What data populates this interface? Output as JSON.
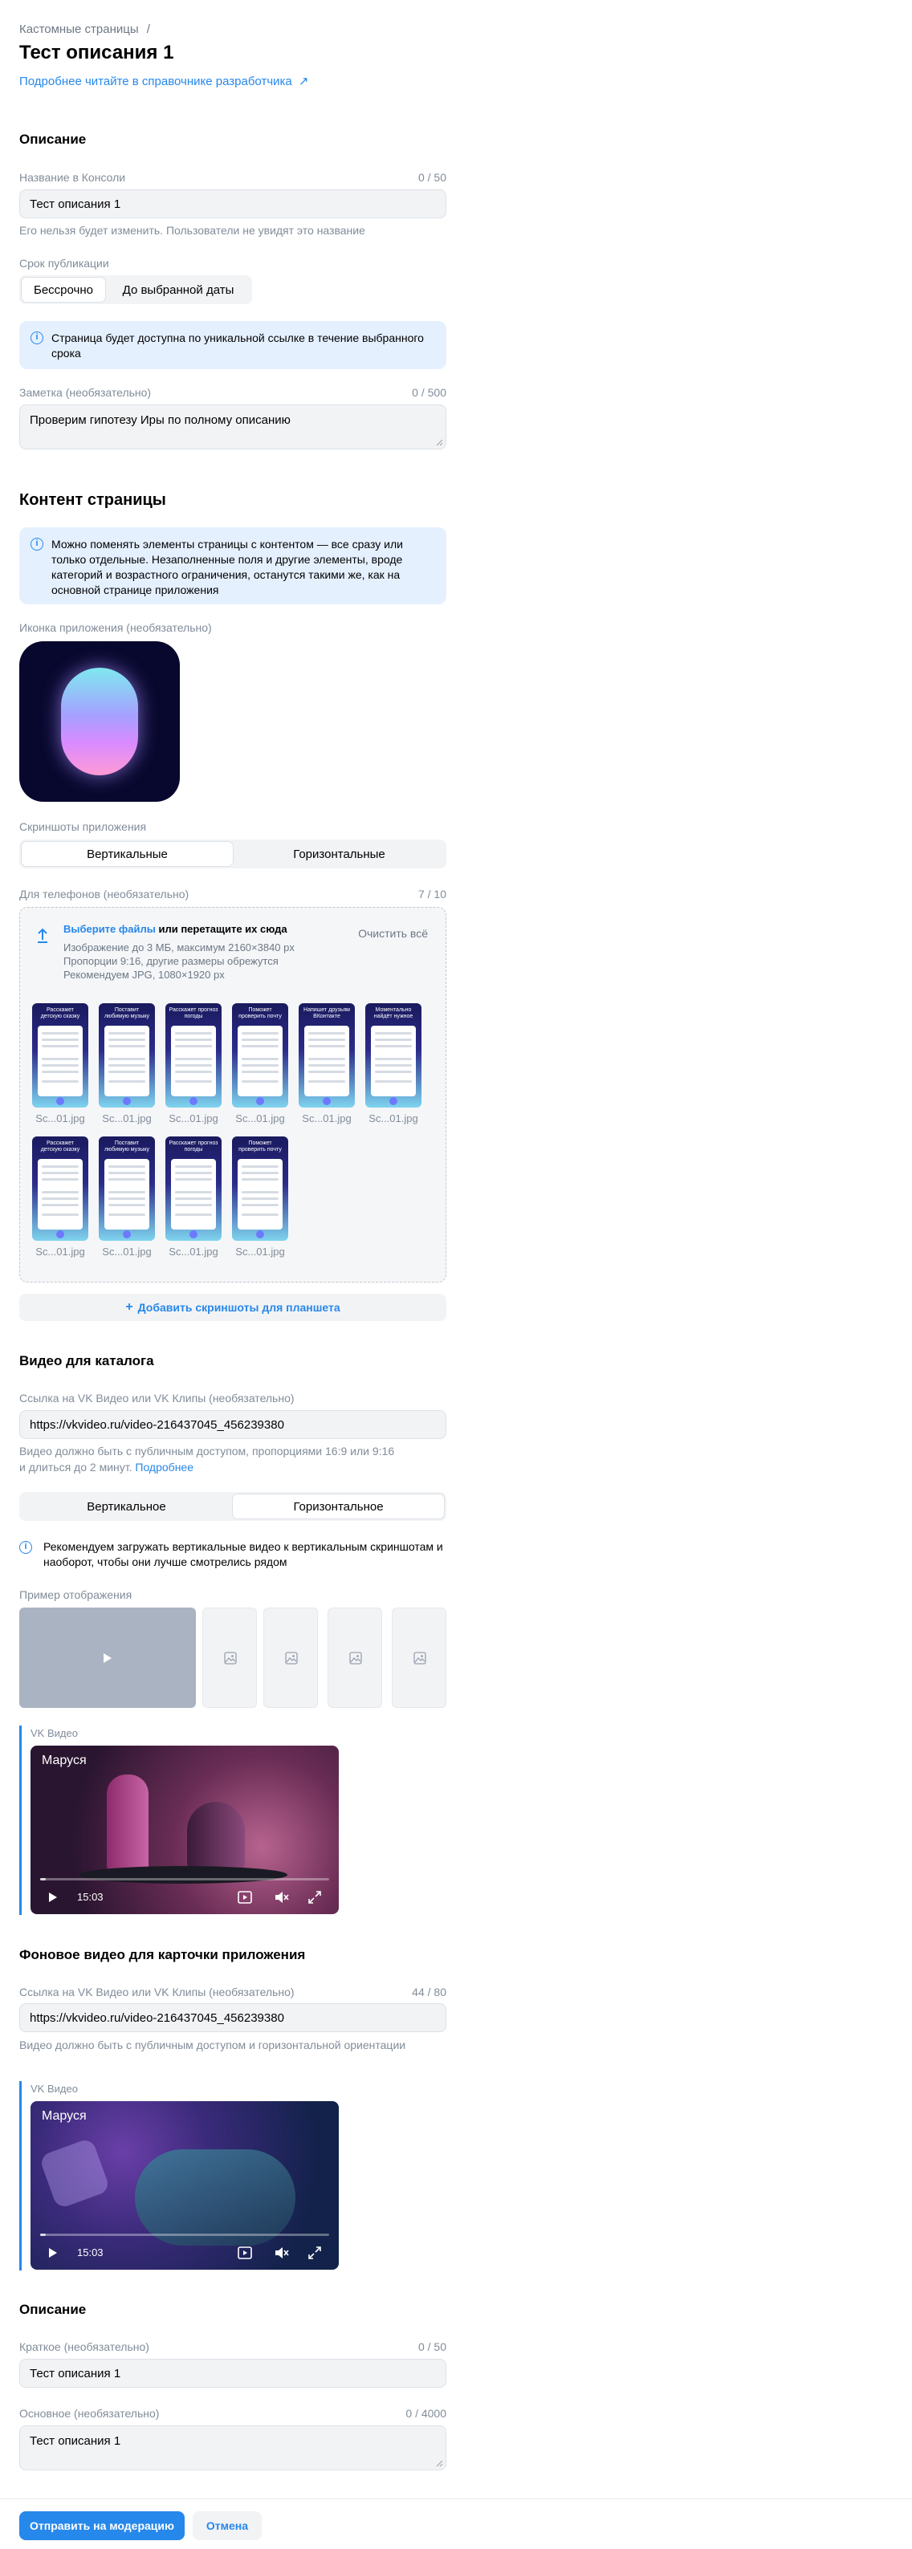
{
  "header": {
    "breadcrumb": "Кастомные страницы",
    "breadcrumb_sep": "/",
    "title": "Тест описания 1",
    "dev_link": "Подробнее читайте в справочнике разработчика"
  },
  "description_section": {
    "heading": "Описание",
    "console_name": {
      "label": "Название в Консоли",
      "counter": "0 / 50",
      "value": "Тест описания 1",
      "hint": "Его нельзя будет изменить. Пользователи не увидят это название"
    },
    "publication": {
      "label": "Срок публикации",
      "options": [
        "Бессрочно",
        "До выбранной даты"
      ],
      "selected": "Бессрочно"
    },
    "info": "Страница будет доступна по уникальной ссылке в течение выбранного срока",
    "note": {
      "label": "Заметка (необязательно)",
      "counter": "0 / 500",
      "value": "Проверим гипотезу Иры по полному описанию"
    }
  },
  "content_section": {
    "heading": "Контент страницы",
    "info": "Можно поменять элементы страницы с контентом — все сразу или только отдельные. Незаполненные поля и другие элементы, вроде категорий и возрастного ограничения, останутся такими же, как на основной странице приложения",
    "icon_label": "Иконка приложения (необязательно)",
    "screenshots_label": "Скриншоты приложения",
    "orientation_tabs": [
      "Вертикальные",
      "Горизонтальные"
    ],
    "orientation_selected": "Вертикальные",
    "phones": {
      "label": "Для телефонов (необязательно)",
      "counter": "7 / 10",
      "upload_link": "Выберите файлы",
      "upload_text": " или перетащите их сюда",
      "req1": "Изображение до 3 МБ, максимум 2160×3840 px",
      "req2": "Пропорции 9:16, другие размеры обрежутся",
      "req3": "Рекомендуем JPG, 1080×1920 px",
      "clear_all": "Очистить всё",
      "files": [
        {
          "name": "Sc...01.jpg",
          "caption": "Расскажет детскую сказку"
        },
        {
          "name": "Sc...01.jpg",
          "caption": "Поставит любимую музыку"
        },
        {
          "name": "Sc...01.jpg",
          "caption": "Расскажет прогноз погоды"
        },
        {
          "name": "Sc...01.jpg",
          "caption": "Поможет проверить почту"
        },
        {
          "name": "Sc...01.jpg",
          "caption": "Напишет друзьям ВКонтакте"
        },
        {
          "name": "Sc...01.jpg",
          "caption": "Моментально найдёт нужное"
        },
        {
          "name": "Sc...01.jpg",
          "caption": "Расскажет детскую сказку"
        },
        {
          "name": "Sc...01.jpg",
          "caption": "Поставит любимую музыку"
        },
        {
          "name": "Sc...01.jpg",
          "caption": "Расскажет прогноз погоды"
        },
        {
          "name": "Sc...01.jpg",
          "caption": "Поможет проверить почту"
        }
      ]
    },
    "add_tablet": "Добавить скриншоты для планшета"
  },
  "catalog_video": {
    "heading": "Видео для каталога",
    "label": "Ссылка на VK Видео или VK Клипы (необязательно)",
    "value": "https://vkvideo.ru/video-216437045_456239380",
    "hint1": "Видео должно быть с публичным доступом, пропорциями 16:9 или 9:16",
    "hint2": "и длиться до 2 минут.",
    "hint_link": "Подробнее",
    "orientation_tabs": [
      "Вертикальное",
      "Горизонтальное"
    ],
    "orientation_selected": "Горизонтальное",
    "info": "Рекомендуем загружать вертикальные видео к вертикальным скриншотам и наоборот, чтобы они лучше смотрелись рядом",
    "preview_label": "Пример отображения",
    "player": {
      "source": "VK Видео",
      "title": "Маруся",
      "time": "15:03",
      "progress": 0.02
    }
  },
  "background_video": {
    "heading": "Фоновое видео для карточки приложения",
    "label": "Ссылка на VK Видео или VK Клипы (необязательно)",
    "counter": "44 / 80",
    "value": "https://vkvideo.ru/video-216437045_456239380",
    "hint": "Видео должно быть с публичным доступом и горизонтальной ориентации",
    "player": {
      "source": "VK Видео",
      "title": "Маруся",
      "time": "15:03",
      "progress": 0.02
    }
  },
  "bottom_description": {
    "heading": "Описание",
    "short": {
      "label": "Краткое (необязательно)",
      "counter": "0 / 50",
      "value": "Тест описания 1"
    },
    "full": {
      "label": "Основное (необязательно)",
      "counter": "0 / 4000",
      "value": "Тест описания 1"
    }
  },
  "footer": {
    "submit": "Отправить на модерацию",
    "cancel": "Отмена"
  },
  "colors": {
    "accent": "#2688eb",
    "info_bg": "#e5f0ff",
    "field_bg": "#f2f3f5"
  }
}
